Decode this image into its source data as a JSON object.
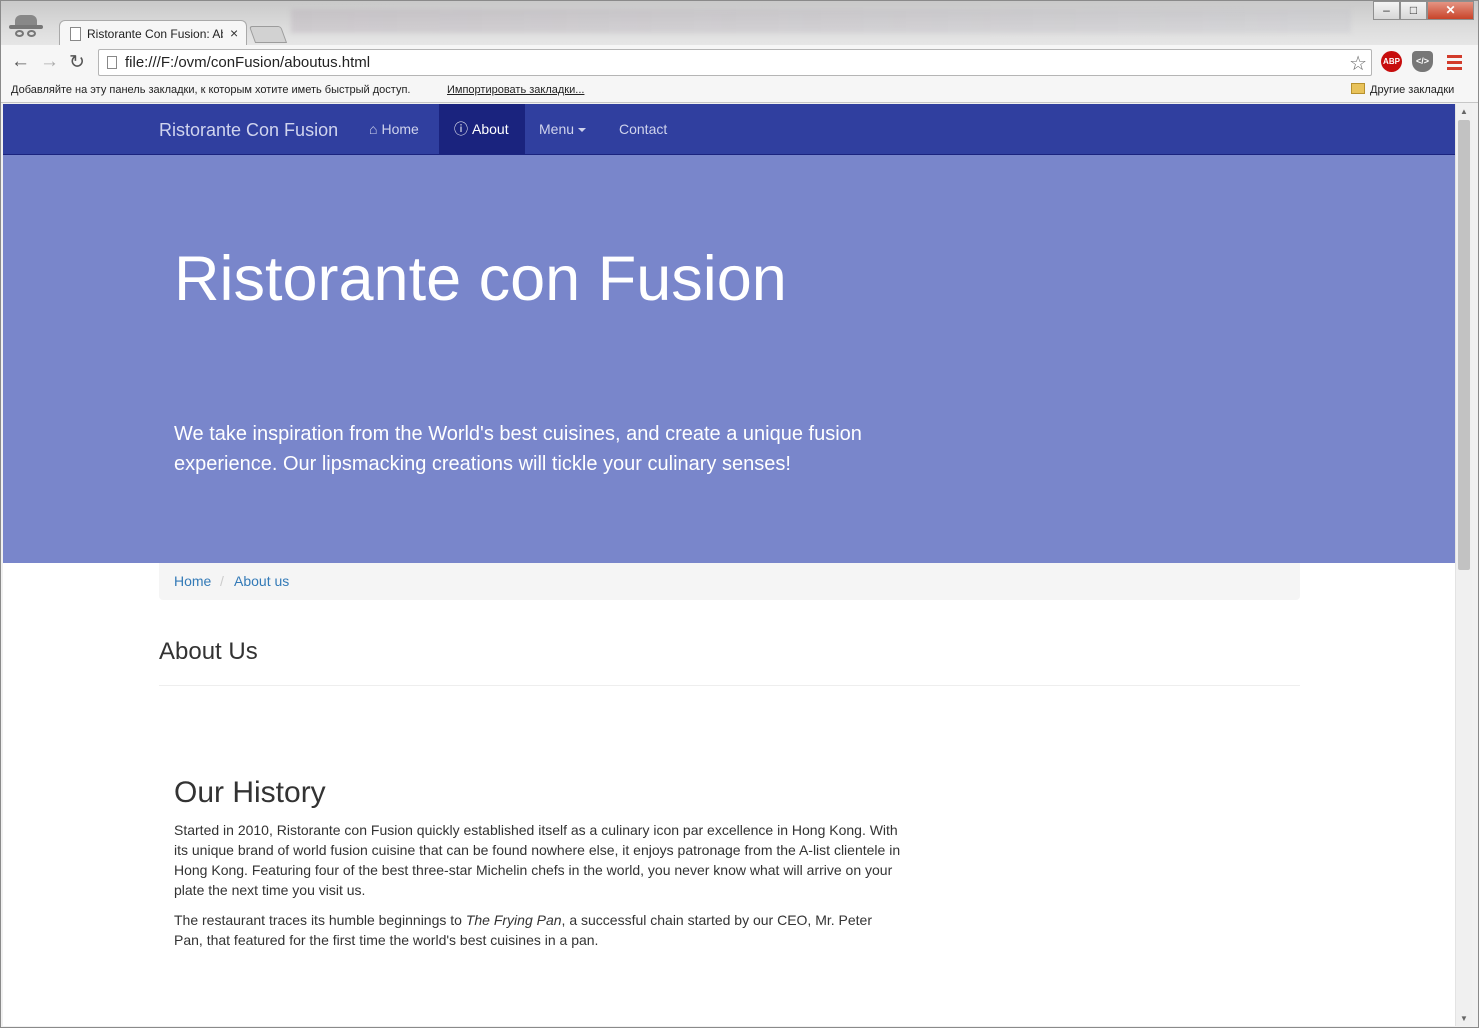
{
  "browser": {
    "tab_title": "Ristorante Con Fusion: Ab",
    "tab_close": "×",
    "url": "file:///F:/ovm/conFusion/aboutus.html",
    "window_controls": {
      "minimize": "–",
      "maximize": "□",
      "close": "✕"
    },
    "extensions": {
      "abp_label": "ABP",
      "code_label": "</>"
    },
    "bookmarks_bar": {
      "hint": "Добавляйте на эту панель закладки, к которым хотите иметь быстрый доступ.",
      "import_link": "Импортировать закладки...",
      "other_bookmarks": "Другие закладки"
    }
  },
  "navbar": {
    "brand": "Ristorante Con Fusion",
    "items": [
      {
        "label": "Home",
        "icon": "home-icon",
        "active": false
      },
      {
        "label": "About",
        "icon": "info-sign-icon",
        "active": true
      },
      {
        "label": "Menu",
        "icon": "caret-down-icon",
        "active": false
      },
      {
        "label": "Contact",
        "active": false
      }
    ]
  },
  "jumbotron": {
    "title": "Ristorante con Fusion",
    "tagline": "We take inspiration from the World's best cuisines, and create a unique fusion experience. Our lipsmacking creations will tickle your culinary senses!"
  },
  "breadcrumb": {
    "items": [
      "Home",
      "About us"
    ],
    "separator": "/"
  },
  "page": {
    "heading": "About Us",
    "history_title": "Our History",
    "history_p1": "Started in 2010, Ristorante con Fusion quickly established itself as a culinary icon par excellence in Hong Kong. With its unique brand of world fusion cuisine that can be found nowhere else, it enjoys patronage from the A-list clientele in Hong Kong. Featuring four of the best three-star Michelin chefs in the world, you never know what will arrive on your plate the next time you visit us.",
    "history_p2_before": "The restaurant traces its humble beginnings to ",
    "history_p2_em": "The Frying Pan",
    "history_p2_after": ", a successful chain started by our CEO, Mr. Peter Pan, that featured for the first time the world's best cuisines in a pan."
  },
  "colors": {
    "navbar": "#303f9f",
    "navbar_active": "#1a237e",
    "jumbotron": "#7986cb",
    "link": "#337ab7"
  }
}
